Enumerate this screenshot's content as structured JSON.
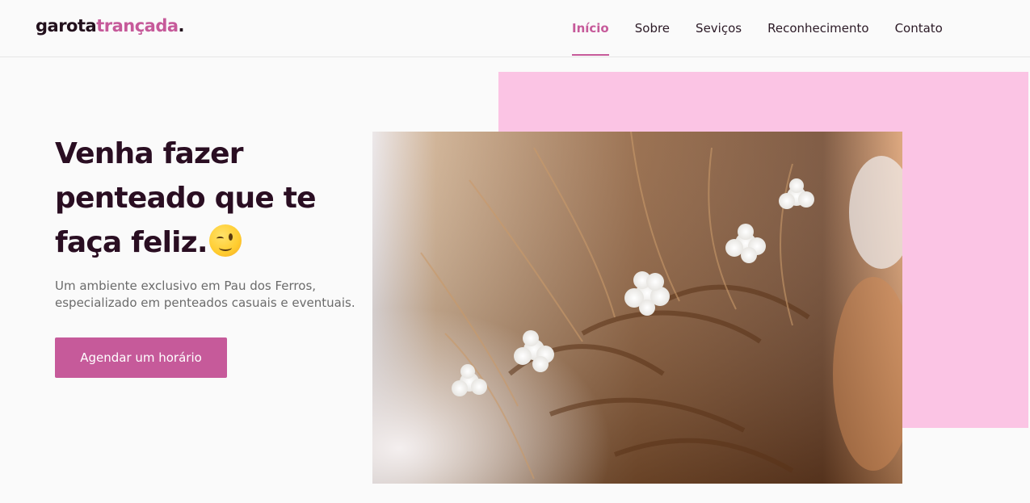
{
  "header": {
    "logo": {
      "part1": "garota",
      "part2": "trançada",
      "part3": "."
    },
    "nav": [
      {
        "label": "Início",
        "active": true
      },
      {
        "label": "Sobre",
        "active": false
      },
      {
        "label": "Seviços",
        "active": false
      },
      {
        "label": "Reconhecimento",
        "active": false
      },
      {
        "label": "Contato",
        "active": false
      }
    ]
  },
  "hero": {
    "title_line1": "Venha fazer",
    "title_line2": "penteado que te",
    "title_line3": "faça feliz.",
    "emoji_icon": "winking-face-emoji",
    "subtitle": "Um ambiente exclusivo em Pau dos Ferros, especializado em penteados casuais e eventuais.",
    "cta_label": "Agendar um horário",
    "photo_icon": "braided-hair-with-flowers-photo"
  },
  "colors": {
    "accent": "#c65a9a",
    "pink_block": "#fbc4e4",
    "heading": "#2a0e22",
    "text_muted": "#6b6b6b",
    "background": "#fafafa"
  }
}
